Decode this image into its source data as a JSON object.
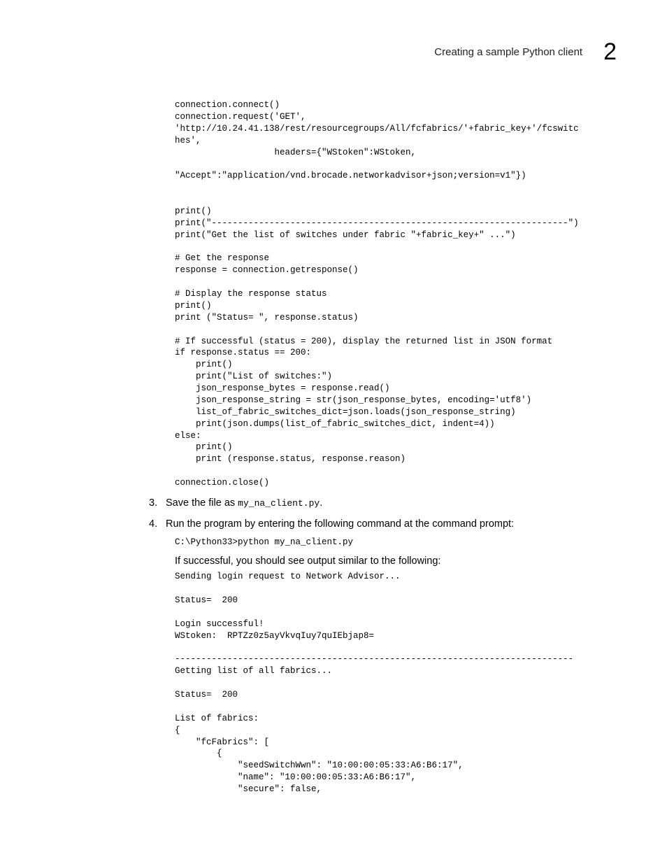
{
  "header": {
    "title": "Creating a sample Python client",
    "chapter": "2"
  },
  "code1": "connection.connect()\nconnection.request('GET', \n'http://10.24.41.138/rest/resourcegroups/All/fcfabrics/'+fabric_key+'/fcswitc\nhes', \n                   headers={\"WStoken\":WStoken, \n\n\"Accept\":\"application/vnd.brocade.networkadvisor+json;version=v1\"})\n\n\nprint()\nprint(\"--------------------------------------------------------------------\")\nprint(\"Get the list of switches under fabric \"+fabric_key+\" ...\")\n\n# Get the response\nresponse = connection.getresponse()\n\n# Display the response status\nprint()\nprint (\"Status= \", response.status)\n\n# If successful (status = 200), display the returned list in JSON format\nif response.status == 200:\n    print()\n    print(\"List of switches:\")\n    json_response_bytes = response.read()\n    json_response_string = str(json_response_bytes, encoding='utf8')\n    list_of_fabric_switches_dict=json.loads(json_response_string)\n    print(json.dumps(list_of_fabric_switches_dict, indent=4))\nelse:\n    print()\n    print (response.status, response.reason)\n\nconnection.close()",
  "step3": {
    "num": "3.",
    "prefix": "Save the file as ",
    "filename": "my_na_client.py",
    "suffix": "."
  },
  "step4": {
    "num": "4.",
    "text": "Run the program by entering the following command at the command prompt:"
  },
  "code2": "C:\\Python33>python my_na_client.py",
  "subtext": "If successful, you should see output similar to the following:",
  "code3": "Sending login request to Network Advisor...\n\nStatus=  200\n\nLogin successful!\nWStoken:  RPTZz0z5ayVkvqIuy7quIEbjap8=\n\n----------------------------------------------------------------------------\nGetting list of all fabrics...\n\nStatus=  200\n\nList of fabrics:\n{\n    \"fcFabrics\": [\n        {\n            \"seedSwitchWwn\": \"10:00:00:05:33:A6:B6:17\",\n            \"name\": \"10:00:00:05:33:A6:B6:17\",\n            \"secure\": false,"
}
